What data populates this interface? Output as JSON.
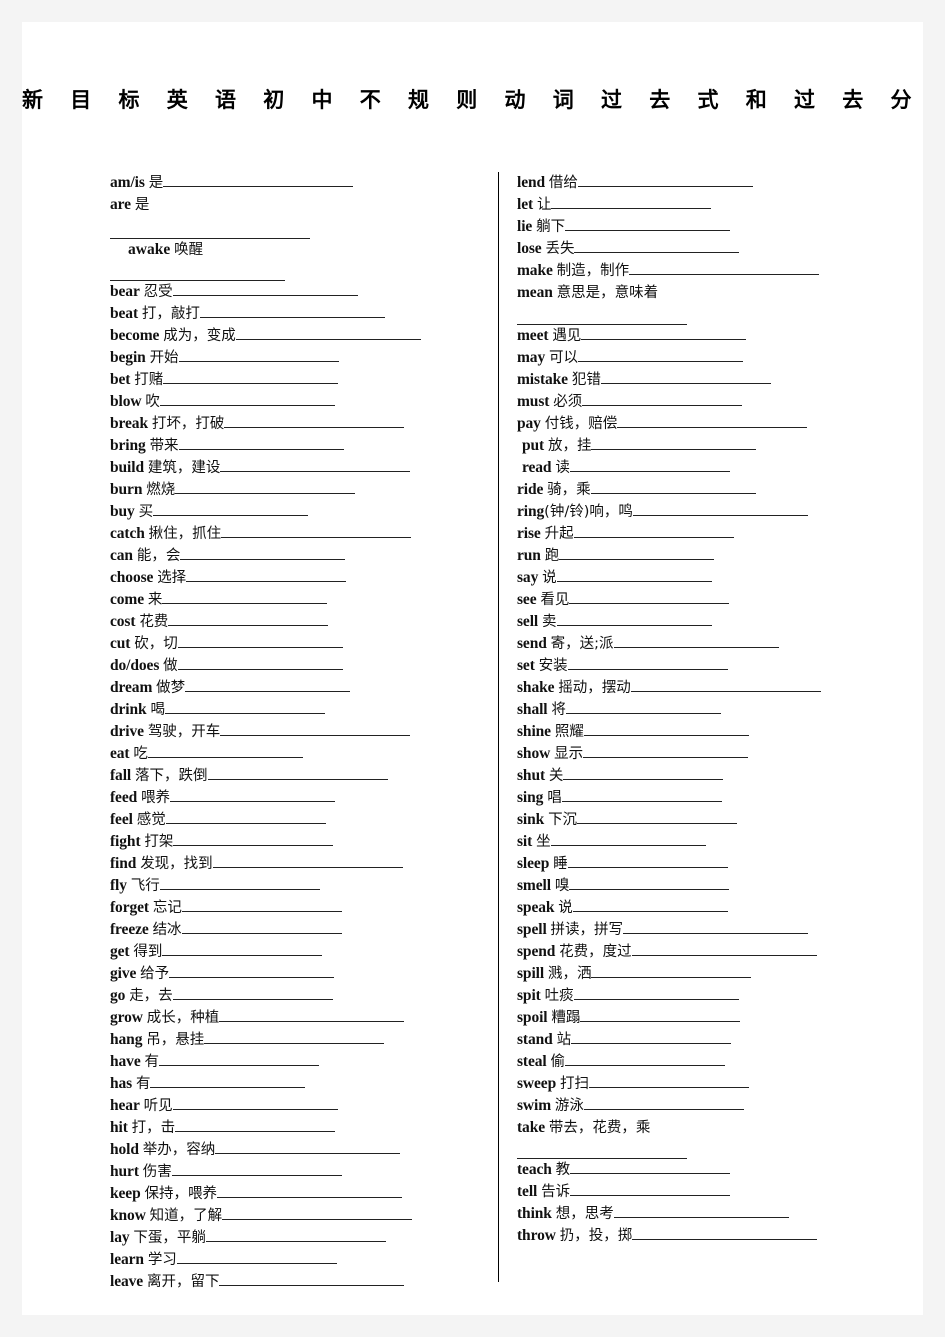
{
  "document": {
    "title": "新 目 标 英 语 初 中 不 规 则 动 词 过 去 式 和 过 去 分 词 表",
    "title_plain": "新目标英语初中不规则动词过去式和过去分词表",
    "page_background": "#ffffff",
    "margin_background": "#f4f4f4",
    "rule_color": "#222222"
  },
  "columns": {
    "left": {
      "entries": [
        {
          "word": "am/is",
          "gloss": "是",
          "blank": 190
        },
        {
          "word": "are",
          "gloss": "是",
          "blank": 200,
          "extra_word": "awake",
          "extra_gloss": "唤醒",
          "wrap_blank": 175
        },
        {
          "word": "bear",
          "gloss": "忍受",
          "blank": 185
        },
        {
          "word": "beat",
          "gloss": "打，敲打",
          "blank": 185
        },
        {
          "word": "become",
          "gloss": "成为，变成",
          "blank": 185
        },
        {
          "word": "begin",
          "gloss": "开始",
          "blank": 160
        },
        {
          "word": "bet",
          "gloss": "打赌",
          "blank": 175
        },
        {
          "word": "blow",
          "gloss": "吹",
          "blank": 175
        },
        {
          "word": "break",
          "gloss": "打坏，打破",
          "blank": 180
        },
        {
          "word": "bring",
          "gloss": "带来",
          "blank": 165
        },
        {
          "word": "build",
          "gloss": "建筑，建设",
          "blank": 190
        },
        {
          "word": "burn",
          "gloss": "燃烧",
          "blank": 180
        },
        {
          "word": "buy",
          "gloss": "买",
          "blank": 155
        },
        {
          "word": "catch",
          "gloss": "揪住，抓住",
          "blank": 190
        },
        {
          "word": "can",
          "gloss": "能，会",
          "blank": 165
        },
        {
          "word": "choose",
          "gloss": "选择",
          "blank": 160
        },
        {
          "word": "come",
          "gloss": "来",
          "blank": 165
        },
        {
          "word": "cost",
          "gloss": "花费",
          "blank": 160
        },
        {
          "word": "cut",
          "gloss": "砍，切",
          "blank": 165
        },
        {
          "word": "do/does",
          "gloss": "做",
          "blank": 165
        },
        {
          "word": "dream",
          "gloss": "做梦",
          "blank": 165
        },
        {
          "word": "drink",
          "gloss": "喝",
          "blank": 160
        },
        {
          "word": "drive",
          "gloss": "驾驶，开车",
          "blank": 190
        },
        {
          "word": "eat",
          "gloss": "吃",
          "blank": 155
        },
        {
          "word": "fall",
          "gloss": "落下，跌倒",
          "blank": 180
        },
        {
          "word": "feed",
          "gloss": "喂养",
          "blank": 165
        },
        {
          "word": "feel",
          "gloss": "感觉",
          "blank": 160
        },
        {
          "word": "fight",
          "gloss": "打架",
          "blank": 160
        },
        {
          "word": "find",
          "gloss": "发现，找到",
          "blank": 190
        },
        {
          "word": "fly",
          "gloss": "飞行",
          "blank": 160
        },
        {
          "word": "forget",
          "gloss": "忘记",
          "blank": 160
        },
        {
          "word": "freeze",
          "gloss": "结冰",
          "blank": 160
        },
        {
          "word": "get",
          "gloss": "得到",
          "blank": 160
        },
        {
          "word": "give",
          "gloss": "给予",
          "blank": 165
        },
        {
          "word": "go",
          "gloss": "走，去",
          "blank": 160
        },
        {
          "word": "grow",
          "gloss": "成长，种植",
          "blank": 185
        },
        {
          "word": "hang",
          "gloss": "吊，悬挂",
          "blank": 180
        },
        {
          "word": "have",
          "gloss": "有",
          "blank": 160
        },
        {
          "word": "has",
          "gloss": "有",
          "blank": 155
        },
        {
          "word": "hear",
          "gloss": "听见",
          "blank": 165
        },
        {
          "word": "hit",
          "gloss": "打，击",
          "blank": 160
        },
        {
          "word": "hold",
          "gloss": "举办，容纳",
          "blank": 185
        },
        {
          "word": "hurt",
          "gloss": "伤害",
          "blank": 170
        },
        {
          "word": "keep",
          "gloss": "保持，喂养",
          "blank": 185
        },
        {
          "word": "know",
          "gloss": "知道，了解",
          "blank": 190
        },
        {
          "word": "lay",
          "gloss": "下蛋，平躺",
          "blank": 180
        },
        {
          "word": "learn",
          "gloss": "学习",
          "blank": 160
        },
        {
          "word": "leave",
          "gloss": "离开，留下",
          "blank": 185
        }
      ]
    },
    "right": {
      "entries": [
        {
          "word": "lend",
          "gloss": "借给",
          "blank": 175
        },
        {
          "word": "let",
          "gloss": "让",
          "blank": 160
        },
        {
          "word": "lie",
          "gloss": "躺下",
          "blank": 165
        },
        {
          "word": "lose",
          "gloss": "丢失",
          "blank": 165
        },
        {
          "word": "make",
          "gloss": "制造，制作",
          "blank": 190
        },
        {
          "word": "mean",
          "gloss": "意思是，意味着",
          "blank": 0,
          "wrap_blank": 170
        },
        {
          "word": "meet",
          "gloss": "遇见",
          "blank": 165
        },
        {
          "word": "may",
          "gloss": "可以",
          "blank": 165
        },
        {
          "word": "mistake",
          "gloss": "犯错",
          "blank": 170
        },
        {
          "word": "must",
          "gloss": "必须",
          "blank": 160
        },
        {
          "word": "pay",
          "gloss": "付钱，赔偿",
          "blank": 190
        },
        {
          "word": "put",
          "gloss": "放，挂",
          "blank": 165,
          "indent": true
        },
        {
          "word": "read",
          "gloss": "读",
          "blank": 160,
          "indent": true
        },
        {
          "word": "ride",
          "gloss": "骑，乘",
          "blank": 165
        },
        {
          "word": "ring",
          "gloss": "(钟/铃)响，鸣",
          "blank": 175,
          "no_space": true
        },
        {
          "word": "rise",
          "gloss": "升起",
          "blank": 160
        },
        {
          "word": "run",
          "gloss": "跑",
          "blank": 155
        },
        {
          "word": "say",
          "gloss": "说",
          "blank": 155
        },
        {
          "word": "see",
          "gloss": "看见",
          "blank": 160
        },
        {
          "word": "sell",
          "gloss": "卖",
          "blank": 155
        },
        {
          "word": "send",
          "gloss": "寄，送;派",
          "blank": 165
        },
        {
          "word": "set",
          "gloss": "安装",
          "blank": 160
        },
        {
          "word": "shake",
          "gloss": "摇动，摆动",
          "blank": 190
        },
        {
          "word": "shall",
          "gloss": "将",
          "blank": 155
        },
        {
          "word": "shine",
          "gloss": "照耀",
          "blank": 165
        },
        {
          "word": "show",
          "gloss": "显示",
          "blank": 165
        },
        {
          "word": "shut",
          "gloss": "关",
          "blank": 160
        },
        {
          "word": "sing",
          "gloss": "唱",
          "blank": 160
        },
        {
          "word": "sink",
          "gloss": "下沉",
          "blank": 160
        },
        {
          "word": "sit",
          "gloss": "坐",
          "blank": 155
        },
        {
          "word": "sleep",
          "gloss": "睡",
          "blank": 160
        },
        {
          "word": "smell",
          "gloss": "嗅",
          "blank": 160
        },
        {
          "word": "speak",
          "gloss": "说",
          "blank": 155
        },
        {
          "word": "spell",
          "gloss": "拼读，拼写",
          "blank": 185
        },
        {
          "word": "spend",
          "gloss": "花费，度过",
          "blank": 185
        },
        {
          "word": "spill",
          "gloss": "溅，洒",
          "blank": 160
        },
        {
          "word": "spit",
          "gloss": "吐痰",
          "blank": 165
        },
        {
          "word": "spoil",
          "gloss": "糟蹋",
          "blank": 160
        },
        {
          "word": "stand",
          "gloss": "站",
          "blank": 160
        },
        {
          "word": "steal",
          "gloss": "偷",
          "blank": 160
        },
        {
          "word": "sweep",
          "gloss": "打扫",
          "blank": 160
        },
        {
          "word": "swim",
          "gloss": "游泳",
          "blank": 160
        },
        {
          "word": "take",
          "gloss": "带去，花费，乘",
          "blank": 0,
          "wrap_blank": 170
        },
        {
          "word": "teach",
          "gloss": "教",
          "blank": 160
        },
        {
          "word": "tell",
          "gloss": "告诉",
          "blank": 160
        },
        {
          "word": "think",
          "gloss": "想，思考",
          "blank": 175
        },
        {
          "word": "throw",
          "gloss": "扔，投，掷",
          "blank": 185
        }
      ]
    }
  }
}
